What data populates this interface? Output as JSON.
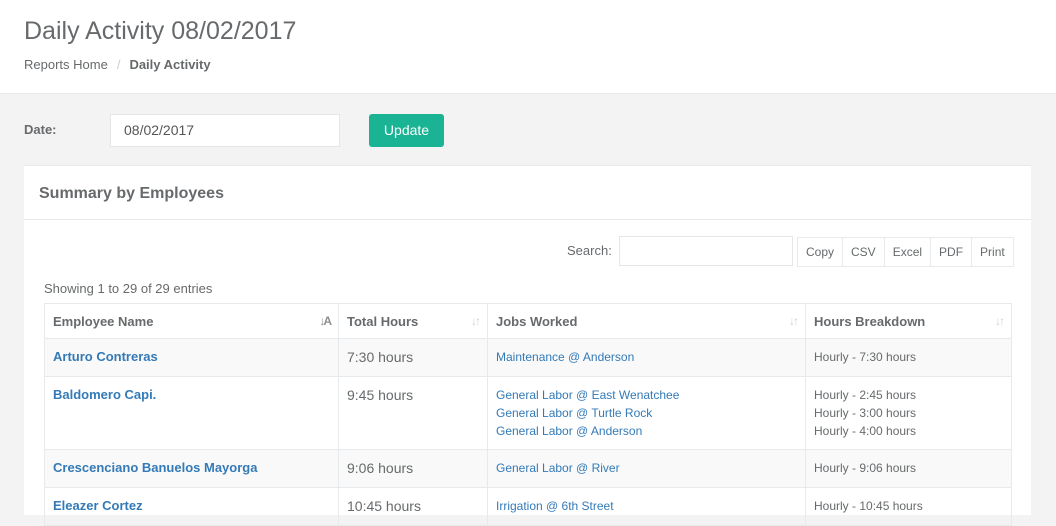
{
  "header": {
    "title": "Daily Activity 08/02/2017",
    "breadcrumb": {
      "home": "Reports Home",
      "separator": "/",
      "current": "Daily Activity"
    }
  },
  "filter": {
    "date_label": "Date:",
    "date_value": "08/02/2017",
    "update_label": "Update"
  },
  "panel": {
    "title": "Summary by Employees",
    "search_label": "Search:",
    "export_buttons": [
      "Copy",
      "CSV",
      "Excel",
      "PDF",
      "Print"
    ],
    "info": "Showing 1 to 29 of 29 entries"
  },
  "table": {
    "columns": [
      "Employee Name",
      "Total Hours",
      "Jobs Worked",
      "Hours Breakdown"
    ],
    "rows": [
      {
        "name": "Arturo Contreras",
        "total": "7:30 hours",
        "jobs": [
          "Maintenance @ Anderson"
        ],
        "breakdown": [
          "Hourly - 7:30 hours"
        ]
      },
      {
        "name": "Baldomero Capi.",
        "total": "9:45 hours",
        "jobs": [
          "General Labor @ East Wenatchee",
          "General Labor @ Turtle Rock",
          "General Labor @ Anderson"
        ],
        "breakdown": [
          "Hourly - 2:45 hours",
          "Hourly - 3:00 hours",
          "Hourly - 4:00 hours"
        ]
      },
      {
        "name": "Crescenciano Banuelos Mayorga",
        "total": "9:06 hours",
        "jobs": [
          "General Labor @ River"
        ],
        "breakdown": [
          "Hourly - 9:06 hours"
        ]
      },
      {
        "name": "Eleazer Cortez",
        "total": "10:45 hours",
        "jobs": [
          "Irrigation @ 6th Street"
        ],
        "breakdown": [
          "Hourly - 10:45 hours"
        ]
      }
    ]
  },
  "colors": {
    "accent": "#1ab394",
    "link": "#337ab7",
    "text": "#676a6c",
    "background": "#f3f3f4"
  }
}
